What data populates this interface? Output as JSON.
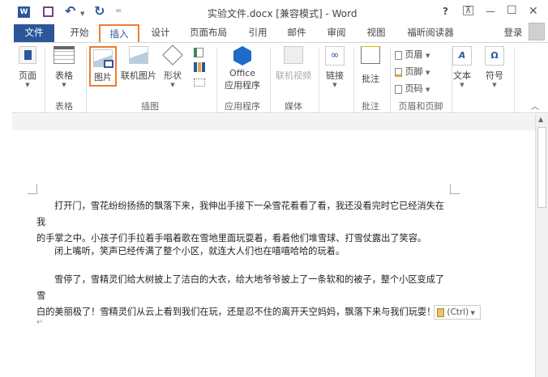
{
  "titlebar": {
    "title": "实验文件.docx [兼容模式] - Word",
    "help": "?",
    "ribbon_display": "⊼",
    "minimize": "—",
    "maximize": "☐",
    "close": "✕",
    "qat_undo": "↶",
    "qat_redo": "↻",
    "qat_more": "="
  },
  "tabs": {
    "file": "文件",
    "items": [
      "开始",
      "插入",
      "设计",
      "页面布局",
      "引用",
      "邮件",
      "审阅",
      "视图",
      "福昕阅读器"
    ],
    "signin": "登录"
  },
  "ribbon": {
    "pages": "页面",
    "table": "表格",
    "picture": "图片",
    "online_picture": "联机图片",
    "shapes": "形状",
    "office_apps_1": "Office",
    "office_apps_2": "应用程序",
    "online_video": "联机视频",
    "link": "链接",
    "comment": "批注",
    "header": "页眉",
    "footer": "页脚",
    "page_number": "页码",
    "text": "文本",
    "symbol": "符号",
    "groups": {
      "table": "表格",
      "illustrations": "插图",
      "apps": "应用程序",
      "media": "媒体",
      "comments": "批注",
      "header_footer": "页眉和页脚"
    }
  },
  "document": {
    "p1_l1": "打开门，雪花纷纷扬扬的飘落下来，我伸出手接下一朵雪花看看了看，我还没看完时它已经消失在我",
    "p1_l2": "的手掌之中。小孩子们手拉着手唱着歌在雪地里面玩耍着，看着他们堆雪球、打雪仗露出了笑容。",
    "p2": "闭上嘴听，笑声已经传满了整个小区，就连大人们也在嘻嘻哈哈的玩着。",
    "p3_l1": "雪停了，雪精灵们给大树披上了洁白的大衣，给大地爷爷披上了一条软和的被子，整个小区变成了雪",
    "p3_l2": "白的美丽极了！雪精灵们从云上看到我们在玩，还是忍不住的离开天空妈妈，飘落下来与我们玩耍！",
    "return_mark": "↵",
    "paste_options": "(Ctrl)"
  },
  "colors": {
    "file_tab": "#2b579a",
    "highlight": "#ed7d31"
  }
}
